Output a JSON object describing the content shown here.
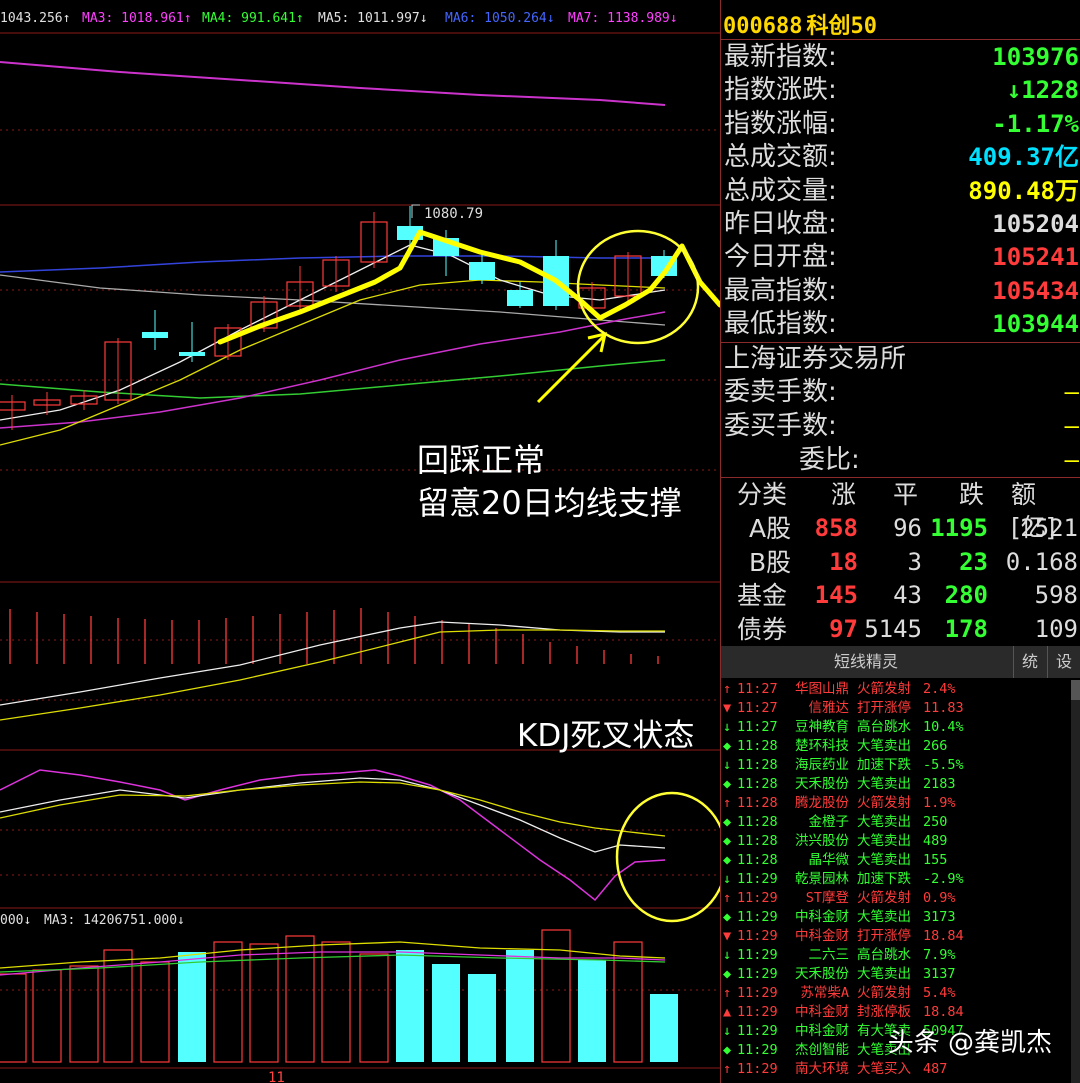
{
  "ma_legend": {
    "ma2": "1043.256↑",
    "ma3": "MA3: 1018.961↑",
    "ma4": "MA4: 991.641↑",
    "ma5": "MA5: 1011.997↓",
    "ma6": "MA6: 1050.264↓",
    "ma7": "MA7: 1138.989↓"
  },
  "volume_legend": {
    "vol_tail": "000↓",
    "vol_ma3": "MA3: 14206751.000↓"
  },
  "high_label": "1080.79",
  "date_label": "11",
  "annotations": {
    "line1": "回踩正常",
    "line2": "留意20日均线支撑",
    "kdj": "KDJ死叉状态"
  },
  "colors": {
    "up": "#ff3b3b",
    "down": "#54ffff",
    "green": "#33ff33",
    "yellow": "#ffff00",
    "cyan": "#00e0ff",
    "white": "#e0e0e0",
    "grid": "#8b1a1a"
  },
  "quote": {
    "code": "000688",
    "name": "科创50",
    "rows": [
      {
        "label": "最新指数:",
        "value": "103976",
        "color": "#33ff33"
      },
      {
        "label": "指数涨跌:",
        "value": "↓1228",
        "color": "#33ff33"
      },
      {
        "label": "指数涨幅:",
        "value": "-1.17%",
        "color": "#33ff33"
      },
      {
        "label": "总成交额:",
        "value": "409.37亿",
        "color": "#00e0ff"
      },
      {
        "label": "总成交量:",
        "value": "890.48万",
        "color": "#ffff00"
      },
      {
        "label": "昨日收盘:",
        "value": "105204",
        "color": "#dddddd"
      },
      {
        "label": "今日开盘:",
        "value": "105241",
        "color": "#ff3b3b"
      },
      {
        "label": "最高指数:",
        "value": "105434",
        "color": "#ff3b3b"
      },
      {
        "label": "最低指数:",
        "value": "103944",
        "color": "#33ff33"
      }
    ],
    "exchange": "上海证券交易所",
    "orders": [
      {
        "label": "委卖手数:",
        "value": "—"
      },
      {
        "label": "委买手数:",
        "value": "—"
      },
      {
        "label": "委比:",
        "value": "—"
      }
    ]
  },
  "stats": {
    "headers": [
      "分类",
      "涨",
      "平",
      "跌",
      "额[亿]"
    ],
    "rows": [
      {
        "cat": "A股",
        "up": "858",
        "flat": "96",
        "down": "1195",
        "amt": "2521"
      },
      {
        "cat": "B股",
        "up": "18",
        "flat": "3",
        "down": "23",
        "amt": "0.168"
      },
      {
        "cat": "基金",
        "up": "145",
        "flat": "43",
        "down": "280",
        "amt": "598"
      },
      {
        "cat": "债券",
        "up": "97",
        "flat": "5145",
        "down": "178",
        "amt": "109"
      }
    ]
  },
  "tabs": {
    "main": "短线精灵",
    "btn1": "统",
    "btn2": "设"
  },
  "feed": [
    {
      "icon": "↑",
      "time": "11:27",
      "name": "华图山鼎",
      "event": "火箭发射",
      "val": "2.4%",
      "color": "#ff3b3b"
    },
    {
      "icon": "▼",
      "time": "11:27",
      "name": "信雅达",
      "event": "打开涨停",
      "val": "11.83",
      "color": "#ff3b3b"
    },
    {
      "icon": "↓",
      "time": "11:27",
      "name": "豆神教育",
      "event": "高台跳水",
      "val": "10.4%",
      "color": "#33ff33"
    },
    {
      "icon": "◆",
      "time": "11:28",
      "name": "楚环科技",
      "event": "大笔卖出",
      "val": "266",
      "color": "#33ff33"
    },
    {
      "icon": "↓",
      "time": "11:28",
      "name": "海辰药业",
      "event": "加速下跌",
      "val": "-5.5%",
      "color": "#33ff33"
    },
    {
      "icon": "◆",
      "time": "11:28",
      "name": "天禾股份",
      "event": "大笔卖出",
      "val": "2183",
      "color": "#33ff33"
    },
    {
      "icon": "↑",
      "time": "11:28",
      "name": "腾龙股份",
      "event": "火箭发射",
      "val": "1.9%",
      "color": "#ff3b3b"
    },
    {
      "icon": "◆",
      "time": "11:28",
      "name": "金橙子",
      "event": "大笔卖出",
      "val": "250",
      "color": "#33ff33"
    },
    {
      "icon": "◆",
      "time": "11:28",
      "name": "洪兴股份",
      "event": "大笔卖出",
      "val": "489",
      "color": "#33ff33"
    },
    {
      "icon": "◆",
      "time": "11:28",
      "name": "晶华微",
      "event": "大笔卖出",
      "val": "155",
      "color": "#33ff33"
    },
    {
      "icon": "↓",
      "time": "11:29",
      "name": "乾景园林",
      "event": "加速下跌",
      "val": "-2.9%",
      "color": "#33ff33"
    },
    {
      "icon": "↑",
      "time": "11:29",
      "name": "ST摩登",
      "event": "火箭发射",
      "val": "0.9%",
      "color": "#ff3b3b"
    },
    {
      "icon": "◆",
      "time": "11:29",
      "name": "中科金财",
      "event": "大笔卖出",
      "val": "3173",
      "color": "#33ff33"
    },
    {
      "icon": "▼",
      "time": "11:29",
      "name": "中科金财",
      "event": "打开涨停",
      "val": "18.84",
      "color": "#ff3b3b"
    },
    {
      "icon": "↓",
      "time": "11:29",
      "name": "二六三",
      "event": "高台跳水",
      "val": "7.9%",
      "color": "#33ff33"
    },
    {
      "icon": "◆",
      "time": "11:29",
      "name": "天禾股份",
      "event": "大笔卖出",
      "val": "3137",
      "color": "#33ff33"
    },
    {
      "icon": "↑",
      "time": "11:29",
      "name": "苏常柴A",
      "event": "火箭发射",
      "val": "5.4%",
      "color": "#ff3b3b"
    },
    {
      "icon": "▲",
      "time": "11:29",
      "name": "中科金财",
      "event": "封涨停板",
      "val": "18.84",
      "color": "#ff3b3b"
    },
    {
      "icon": "↓",
      "time": "11:29",
      "name": "中科金财",
      "event": "有大笔卖",
      "val": "50947",
      "color": "#33ff33"
    },
    {
      "icon": "◆",
      "time": "11:29",
      "name": "杰创智能",
      "event": "大笔卖出",
      "val": "",
      "color": "#33ff33"
    },
    {
      "icon": "↑",
      "time": "11:29",
      "name": "南大环境",
      "event": "大笔买入",
      "val": "487",
      "color": "#ff3b3b"
    }
  ],
  "watermark": "头条 @龚凯杰"
}
